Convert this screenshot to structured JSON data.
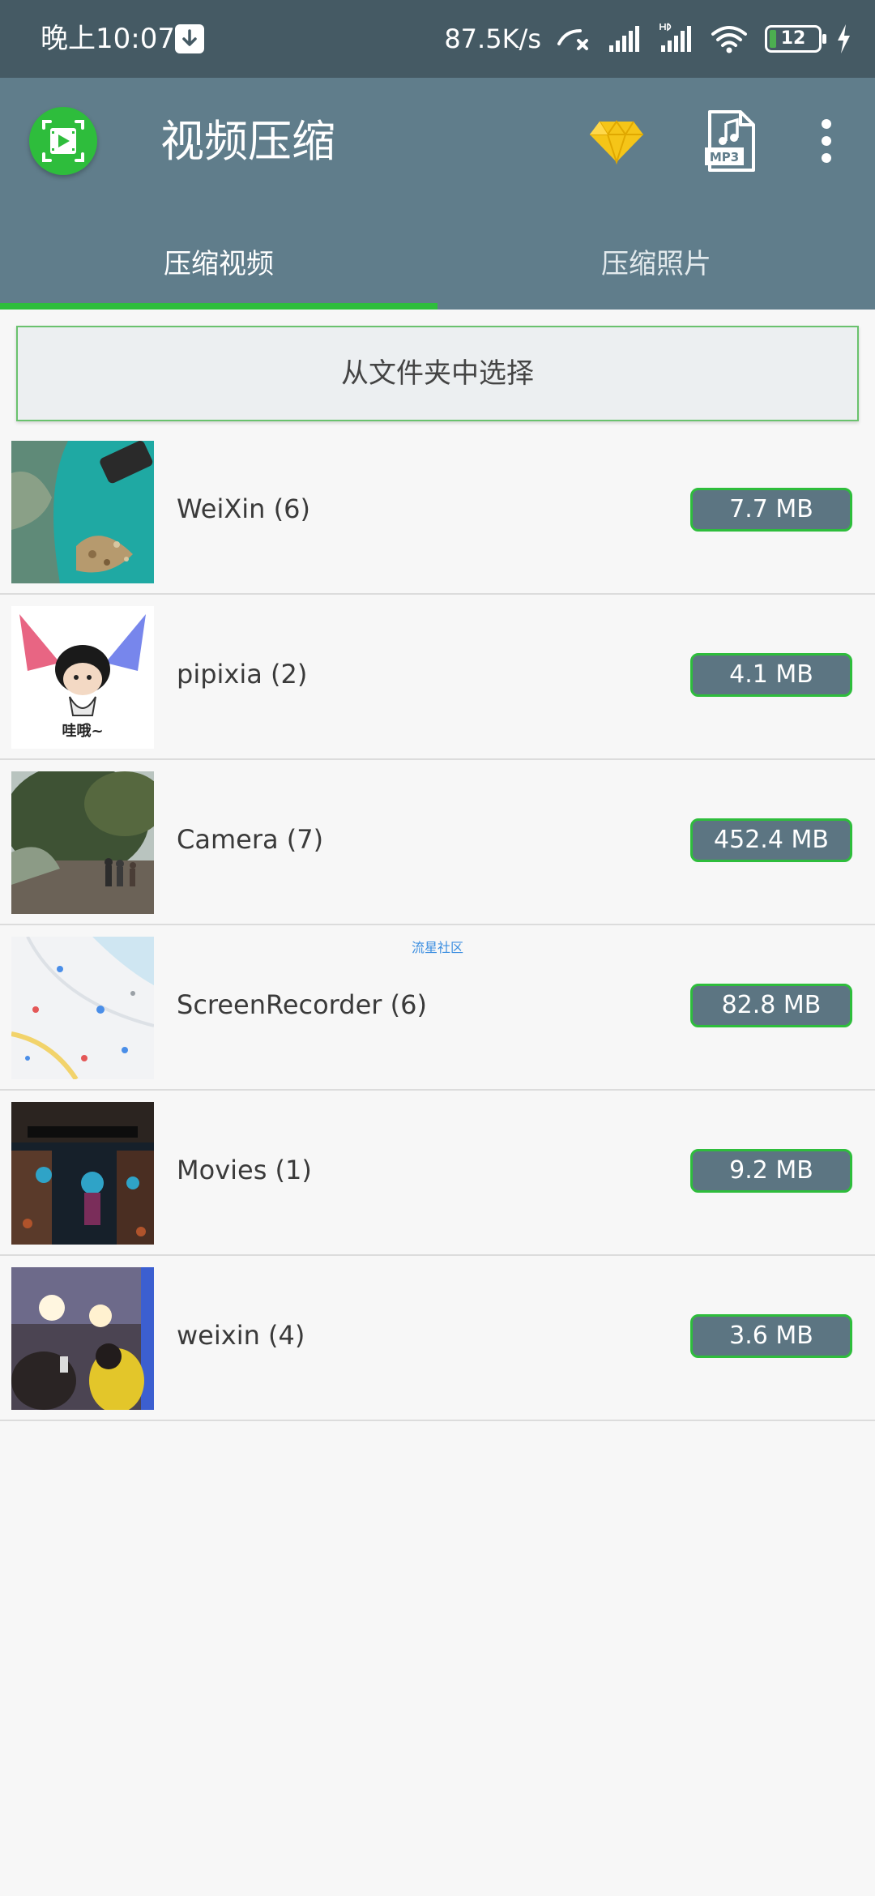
{
  "status_bar": {
    "time": "晚上10:07",
    "net_speed": "87.5K/s",
    "battery_level": "12"
  },
  "app_bar": {
    "title": "视频压缩",
    "tabs": [
      {
        "label": "压缩视频",
        "active": true
      },
      {
        "label": "压缩照片",
        "active": false
      }
    ],
    "accent_color": "#2ebd3c",
    "primary_color": "#607d8b"
  },
  "main": {
    "select_folder_label": "从文件夹中选择",
    "watermark": "流星社区",
    "folders": [
      {
        "name": "WeiXin (6)",
        "size": "7.7 MB"
      },
      {
        "name": "pipixia (2)",
        "size": "4.1 MB"
      },
      {
        "name": "Camera (7)",
        "size": "452.4 MB"
      },
      {
        "name": "ScreenRecorder (6)",
        "size": "82.8 MB"
      },
      {
        "name": "Movies (1)",
        "size": "9.2 MB"
      },
      {
        "name": "weixin (4)",
        "size": "3.6 MB"
      }
    ],
    "thumbnail_badge_text": "哇哦~"
  },
  "icons": {
    "download": "download-icon",
    "premium": "diamond-icon",
    "mp3": "mp3-file-icon",
    "more": "more-vert-icon",
    "logo": "video-compress-logo"
  },
  "icon_labels": {
    "mp3": "MP3"
  }
}
